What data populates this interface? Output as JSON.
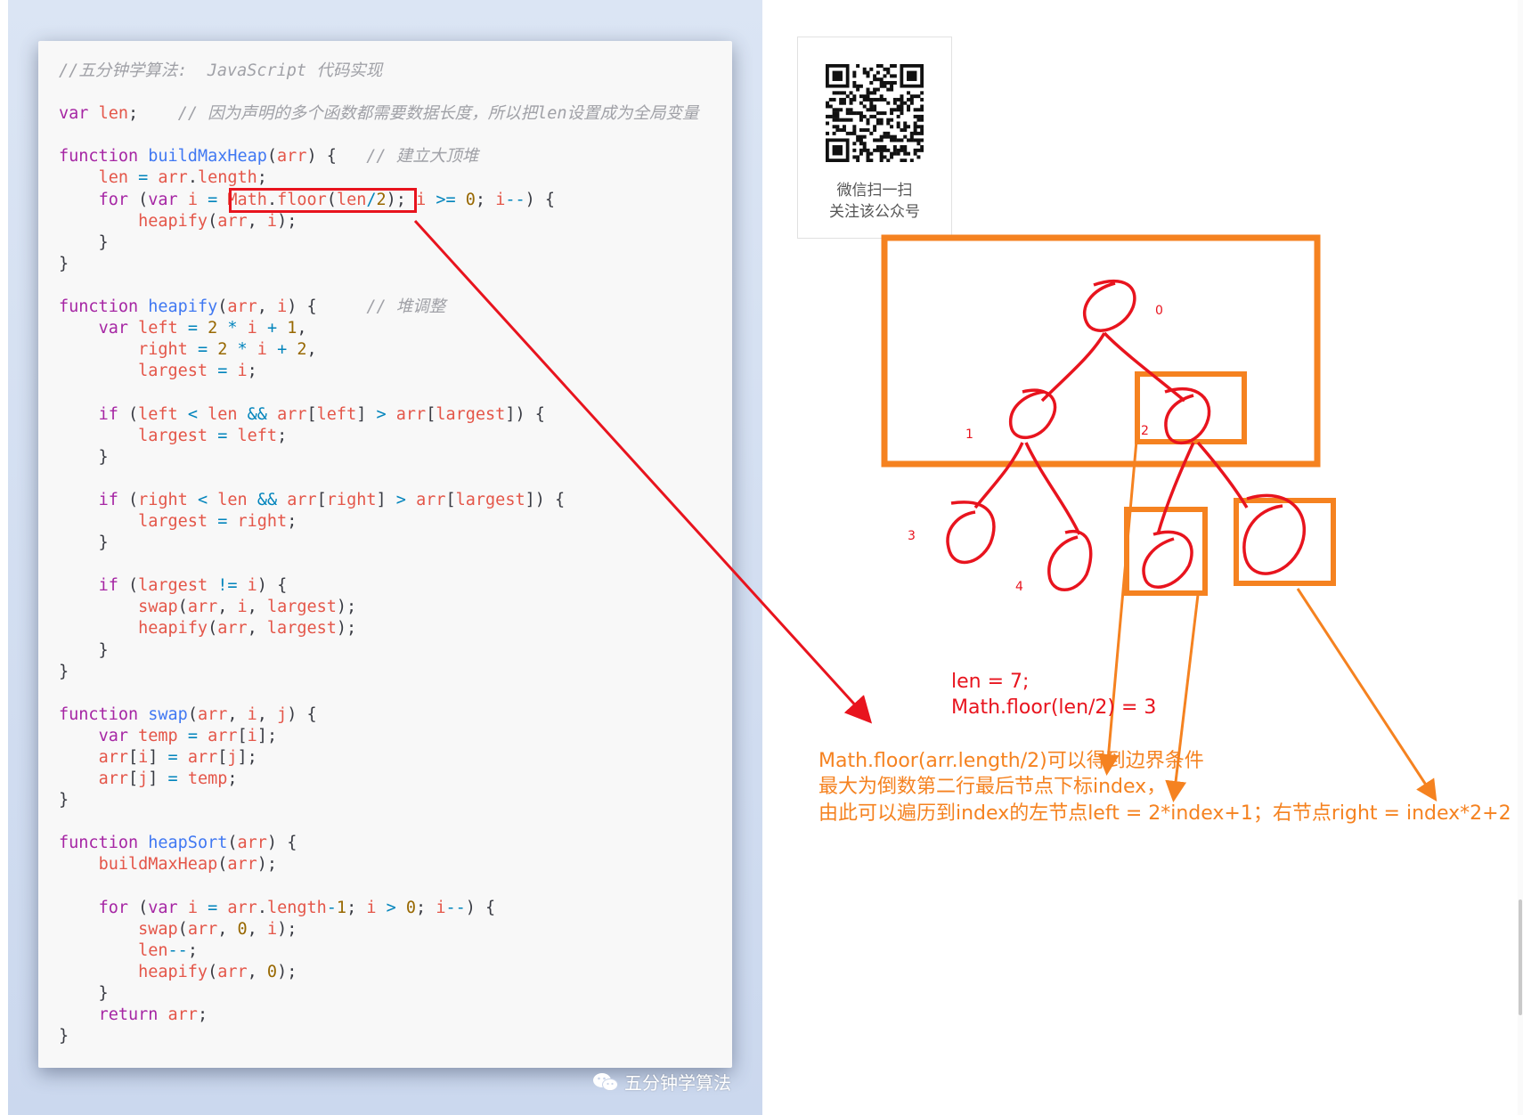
{
  "code": {
    "lines": [
      [
        [
          "cm",
          "//五分钟学算法:  JavaScript 代码实现"
        ]
      ],
      [],
      [
        [
          "kw",
          "var"
        ],
        [
          "pl",
          " "
        ],
        [
          "pa",
          "len"
        ],
        [
          "pl",
          ";    "
        ],
        [
          "cm",
          "// 因为声明的多个函数都需要数据长度，所以把len设置成为全局变量"
        ]
      ],
      [],
      [
        [
          "kw",
          "function"
        ],
        [
          "pl",
          " "
        ],
        [
          "fn",
          "buildMaxHeap"
        ],
        [
          "pl",
          "("
        ],
        [
          "pa",
          "arr"
        ],
        [
          "pl",
          ") {   "
        ],
        [
          "cm",
          "// 建立大顶堆"
        ]
      ],
      [
        [
          "pl",
          "    "
        ],
        [
          "pa",
          "len"
        ],
        [
          "pl",
          " "
        ],
        [
          "op",
          "="
        ],
        [
          "pl",
          " "
        ],
        [
          "pa",
          "arr"
        ],
        [
          "pl",
          "."
        ],
        [
          "pa",
          "length"
        ],
        [
          "pl",
          ";"
        ]
      ],
      [
        [
          "pl",
          "    "
        ],
        [
          "kw",
          "for"
        ],
        [
          "pl",
          " ("
        ],
        [
          "kw",
          "var"
        ],
        [
          "pl",
          " "
        ],
        [
          "pa",
          "i"
        ],
        [
          "pl",
          " "
        ],
        [
          "op",
          "="
        ],
        [
          "pl",
          " "
        ],
        [
          "pa",
          "Math"
        ],
        [
          "pl",
          "."
        ],
        [
          "pa",
          "floor"
        ],
        [
          "pl",
          "("
        ],
        [
          "pa",
          "len"
        ],
        [
          "op",
          "/"
        ],
        [
          "nu",
          "2"
        ],
        [
          "pl",
          ");"
        ],
        [
          "pl",
          " "
        ],
        [
          "pa",
          "i"
        ],
        [
          "pl",
          " "
        ],
        [
          "op",
          ">="
        ],
        [
          "pl",
          " "
        ],
        [
          "nu",
          "0"
        ],
        [
          "pl",
          "; "
        ],
        [
          "pa",
          "i"
        ],
        [
          "op",
          "--"
        ],
        [
          "pl",
          ") {"
        ]
      ],
      [
        [
          "pl",
          "        "
        ],
        [
          "pa",
          "heapify"
        ],
        [
          "pl",
          "("
        ],
        [
          "pa",
          "arr"
        ],
        [
          "pl",
          ", "
        ],
        [
          "pa",
          "i"
        ],
        [
          "pl",
          ");"
        ]
      ],
      [
        [
          "pl",
          "    }"
        ]
      ],
      [
        [
          "pl",
          "}"
        ]
      ],
      [],
      [
        [
          "kw",
          "function"
        ],
        [
          "pl",
          " "
        ],
        [
          "fn",
          "heapify"
        ],
        [
          "pl",
          "("
        ],
        [
          "pa",
          "arr"
        ],
        [
          "pl",
          ", "
        ],
        [
          "pa",
          "i"
        ],
        [
          "pl",
          ") {     "
        ],
        [
          "cm",
          "// 堆调整"
        ]
      ],
      [
        [
          "pl",
          "    "
        ],
        [
          "kw",
          "var"
        ],
        [
          "pl",
          " "
        ],
        [
          "pa",
          "left"
        ],
        [
          "pl",
          " "
        ],
        [
          "op",
          "="
        ],
        [
          "pl",
          " "
        ],
        [
          "nu",
          "2"
        ],
        [
          "pl",
          " "
        ],
        [
          "op",
          "*"
        ],
        [
          "pl",
          " "
        ],
        [
          "pa",
          "i"
        ],
        [
          "pl",
          " "
        ],
        [
          "op",
          "+"
        ],
        [
          "pl",
          " "
        ],
        [
          "nu",
          "1"
        ],
        [
          "pl",
          ","
        ]
      ],
      [
        [
          "pl",
          "        "
        ],
        [
          "pa",
          "right"
        ],
        [
          "pl",
          " "
        ],
        [
          "op",
          "="
        ],
        [
          "pl",
          " "
        ],
        [
          "nu",
          "2"
        ],
        [
          "pl",
          " "
        ],
        [
          "op",
          "*"
        ],
        [
          "pl",
          " "
        ],
        [
          "pa",
          "i"
        ],
        [
          "pl",
          " "
        ],
        [
          "op",
          "+"
        ],
        [
          "pl",
          " "
        ],
        [
          "nu",
          "2"
        ],
        [
          "pl",
          ","
        ]
      ],
      [
        [
          "pl",
          "        "
        ],
        [
          "pa",
          "largest"
        ],
        [
          "pl",
          " "
        ],
        [
          "op",
          "="
        ],
        [
          "pl",
          " "
        ],
        [
          "pa",
          "i"
        ],
        [
          "pl",
          ";"
        ]
      ],
      [],
      [
        [
          "pl",
          "    "
        ],
        [
          "kw",
          "if"
        ],
        [
          "pl",
          " ("
        ],
        [
          "pa",
          "left"
        ],
        [
          "pl",
          " "
        ],
        [
          "op",
          "<"
        ],
        [
          "pl",
          " "
        ],
        [
          "pa",
          "len"
        ],
        [
          "pl",
          " "
        ],
        [
          "op",
          "&&"
        ],
        [
          "pl",
          " "
        ],
        [
          "pa",
          "arr"
        ],
        [
          "pl",
          "["
        ],
        [
          "pa",
          "left"
        ],
        [
          "pl",
          "] "
        ],
        [
          "op",
          ">"
        ],
        [
          "pl",
          " "
        ],
        [
          "pa",
          "arr"
        ],
        [
          "pl",
          "["
        ],
        [
          "pa",
          "largest"
        ],
        [
          "pl",
          "]) {"
        ]
      ],
      [
        [
          "pl",
          "        "
        ],
        [
          "pa",
          "largest"
        ],
        [
          "pl",
          " "
        ],
        [
          "op",
          "="
        ],
        [
          "pl",
          " "
        ],
        [
          "pa",
          "left"
        ],
        [
          "pl",
          ";"
        ]
      ],
      [
        [
          "pl",
          "    }"
        ]
      ],
      [],
      [
        [
          "pl",
          "    "
        ],
        [
          "kw",
          "if"
        ],
        [
          "pl",
          " ("
        ],
        [
          "pa",
          "right"
        ],
        [
          "pl",
          " "
        ],
        [
          "op",
          "<"
        ],
        [
          "pl",
          " "
        ],
        [
          "pa",
          "len"
        ],
        [
          "pl",
          " "
        ],
        [
          "op",
          "&&"
        ],
        [
          "pl",
          " "
        ],
        [
          "pa",
          "arr"
        ],
        [
          "pl",
          "["
        ],
        [
          "pa",
          "right"
        ],
        [
          "pl",
          "] "
        ],
        [
          "op",
          ">"
        ],
        [
          "pl",
          " "
        ],
        [
          "pa",
          "arr"
        ],
        [
          "pl",
          "["
        ],
        [
          "pa",
          "largest"
        ],
        [
          "pl",
          "]) {"
        ]
      ],
      [
        [
          "pl",
          "        "
        ],
        [
          "pa",
          "largest"
        ],
        [
          "pl",
          " "
        ],
        [
          "op",
          "="
        ],
        [
          "pl",
          " "
        ],
        [
          "pa",
          "right"
        ],
        [
          "pl",
          ";"
        ]
      ],
      [
        [
          "pl",
          "    }"
        ]
      ],
      [],
      [
        [
          "pl",
          "    "
        ],
        [
          "kw",
          "if"
        ],
        [
          "pl",
          " ("
        ],
        [
          "pa",
          "largest"
        ],
        [
          "pl",
          " "
        ],
        [
          "op",
          "!="
        ],
        [
          "pl",
          " "
        ],
        [
          "pa",
          "i"
        ],
        [
          "pl",
          ") {"
        ]
      ],
      [
        [
          "pl",
          "        "
        ],
        [
          "pa",
          "swap"
        ],
        [
          "pl",
          "("
        ],
        [
          "pa",
          "arr"
        ],
        [
          "pl",
          ", "
        ],
        [
          "pa",
          "i"
        ],
        [
          "pl",
          ", "
        ],
        [
          "pa",
          "largest"
        ],
        [
          "pl",
          ");"
        ]
      ],
      [
        [
          "pl",
          "        "
        ],
        [
          "pa",
          "heapify"
        ],
        [
          "pl",
          "("
        ],
        [
          "pa",
          "arr"
        ],
        [
          "pl",
          ", "
        ],
        [
          "pa",
          "largest"
        ],
        [
          "pl",
          ");"
        ]
      ],
      [
        [
          "pl",
          "    }"
        ]
      ],
      [
        [
          "pl",
          "}"
        ]
      ],
      [],
      [
        [
          "kw",
          "function"
        ],
        [
          "pl",
          " "
        ],
        [
          "fn",
          "swap"
        ],
        [
          "pl",
          "("
        ],
        [
          "pa",
          "arr"
        ],
        [
          "pl",
          ", "
        ],
        [
          "pa",
          "i"
        ],
        [
          "pl",
          ", "
        ],
        [
          "pa",
          "j"
        ],
        [
          "pl",
          ") {"
        ]
      ],
      [
        [
          "pl",
          "    "
        ],
        [
          "kw",
          "var"
        ],
        [
          "pl",
          " "
        ],
        [
          "pa",
          "temp"
        ],
        [
          "pl",
          " "
        ],
        [
          "op",
          "="
        ],
        [
          "pl",
          " "
        ],
        [
          "pa",
          "arr"
        ],
        [
          "pl",
          "["
        ],
        [
          "pa",
          "i"
        ],
        [
          "pl",
          "];"
        ]
      ],
      [
        [
          "pl",
          "    "
        ],
        [
          "pa",
          "arr"
        ],
        [
          "pl",
          "["
        ],
        [
          "pa",
          "i"
        ],
        [
          "pl",
          "] "
        ],
        [
          "op",
          "="
        ],
        [
          "pl",
          " "
        ],
        [
          "pa",
          "arr"
        ],
        [
          "pl",
          "["
        ],
        [
          "pa",
          "j"
        ],
        [
          "pl",
          "];"
        ]
      ],
      [
        [
          "pl",
          "    "
        ],
        [
          "pa",
          "arr"
        ],
        [
          "pl",
          "["
        ],
        [
          "pa",
          "j"
        ],
        [
          "pl",
          "] "
        ],
        [
          "op",
          "="
        ],
        [
          "pl",
          " "
        ],
        [
          "pa",
          "temp"
        ],
        [
          "pl",
          ";"
        ]
      ],
      [
        [
          "pl",
          "}"
        ]
      ],
      [],
      [
        [
          "kw",
          "function"
        ],
        [
          "pl",
          " "
        ],
        [
          "fn",
          "heapSort"
        ],
        [
          "pl",
          "("
        ],
        [
          "pa",
          "arr"
        ],
        [
          "pl",
          ") {"
        ]
      ],
      [
        [
          "pl",
          "    "
        ],
        [
          "pa",
          "buildMaxHeap"
        ],
        [
          "pl",
          "("
        ],
        [
          "pa",
          "arr"
        ],
        [
          "pl",
          ");"
        ]
      ],
      [],
      [
        [
          "pl",
          "    "
        ],
        [
          "kw",
          "for"
        ],
        [
          "pl",
          " ("
        ],
        [
          "kw",
          "var"
        ],
        [
          "pl",
          " "
        ],
        [
          "pa",
          "i"
        ],
        [
          "pl",
          " "
        ],
        [
          "op",
          "="
        ],
        [
          "pl",
          " "
        ],
        [
          "pa",
          "arr"
        ],
        [
          "pl",
          "."
        ],
        [
          "pa",
          "length"
        ],
        [
          "op",
          "-"
        ],
        [
          "nu",
          "1"
        ],
        [
          "pl",
          "; "
        ],
        [
          "pa",
          "i"
        ],
        [
          "pl",
          " "
        ],
        [
          "op",
          ">"
        ],
        [
          "pl",
          " "
        ],
        [
          "nu",
          "0"
        ],
        [
          "pl",
          "; "
        ],
        [
          "pa",
          "i"
        ],
        [
          "op",
          "--"
        ],
        [
          "pl",
          ") {"
        ]
      ],
      [
        [
          "pl",
          "        "
        ],
        [
          "pa",
          "swap"
        ],
        [
          "pl",
          "("
        ],
        [
          "pa",
          "arr"
        ],
        [
          "pl",
          ", "
        ],
        [
          "nu",
          "0"
        ],
        [
          "pl",
          ", "
        ],
        [
          "pa",
          "i"
        ],
        [
          "pl",
          ");"
        ]
      ],
      [
        [
          "pl",
          "        "
        ],
        [
          "pa",
          "len"
        ],
        [
          "op",
          "--"
        ],
        [
          "pl",
          ";"
        ]
      ],
      [
        [
          "pl",
          "        "
        ],
        [
          "pa",
          "heapify"
        ],
        [
          "pl",
          "("
        ],
        [
          "pa",
          "arr"
        ],
        [
          "pl",
          ", "
        ],
        [
          "nu",
          "0"
        ],
        [
          "pl",
          ");"
        ]
      ],
      [
        [
          "pl",
          "    }"
        ]
      ],
      [
        [
          "pl",
          "    "
        ],
        [
          "kw",
          "return"
        ],
        [
          "pl",
          " "
        ],
        [
          "pa",
          "arr"
        ],
        [
          "pl",
          ";"
        ]
      ],
      [
        [
          "pl",
          "}"
        ]
      ]
    ]
  },
  "watermark": {
    "text": "五分钟学算法",
    "icon": "wechat-icon"
  },
  "qr": {
    "line1": "微信扫一扫",
    "line2": "关注该公众号",
    "icon": "qr-code-icon"
  },
  "tree": {
    "node_labels": [
      "0",
      "1",
      "2",
      "3",
      "4"
    ]
  },
  "notes": {
    "len_line": "len = 7;",
    "floor_line": "Math.floor(len/2) = 3",
    "explain_1": "Math.floor(arr.length/2)可以得到边界条件",
    "explain_2": "最大为倒数第二行最后节点下标index，",
    "explain_3": "由此可以遍历到index的左节点left = 2*index+1；右节点right = index*2+2"
  },
  "colors": {
    "annotation_red": "#e8141e",
    "annotation_orange": "#f58220",
    "code_bg": "#f8f8f8",
    "panel_bg": "#d4def0"
  }
}
